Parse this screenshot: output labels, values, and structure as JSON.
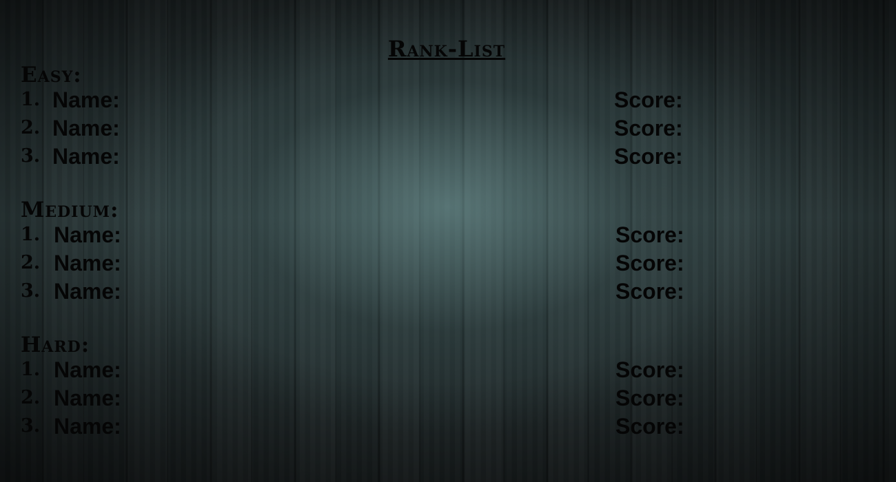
{
  "page_title": "Rank-List",
  "sections": [
    {
      "title": "Easy:",
      "rows": [
        {
          "rank": "1.",
          "name_label": "Name:",
          "score_label": "Score:"
        },
        {
          "rank": "2.",
          "name_label": "Name:",
          "score_label": "Score:"
        },
        {
          "rank": "3.",
          "name_label": "Name:",
          "score_label": "Score:"
        }
      ]
    },
    {
      "title": "Medium:",
      "rows": [
        {
          "rank": "1.",
          "name_label": "Name:",
          "score_label": "Score:"
        },
        {
          "rank": "2.",
          "name_label": "Name:",
          "score_label": "Score:"
        },
        {
          "rank": "3.",
          "name_label": "Name:",
          "score_label": "Score:"
        }
      ]
    },
    {
      "title": "Hard:",
      "rows": [
        {
          "rank": "1.",
          "name_label": "Name:",
          "score_label": "Score:"
        },
        {
          "rank": "2.",
          "name_label": "Name:",
          "score_label": "Score:"
        },
        {
          "rank": "3.",
          "name_label": "Name:",
          "score_label": "Score:"
        }
      ]
    }
  ],
  "colors": {
    "text": "#050505",
    "background": "#2f3e3f"
  }
}
